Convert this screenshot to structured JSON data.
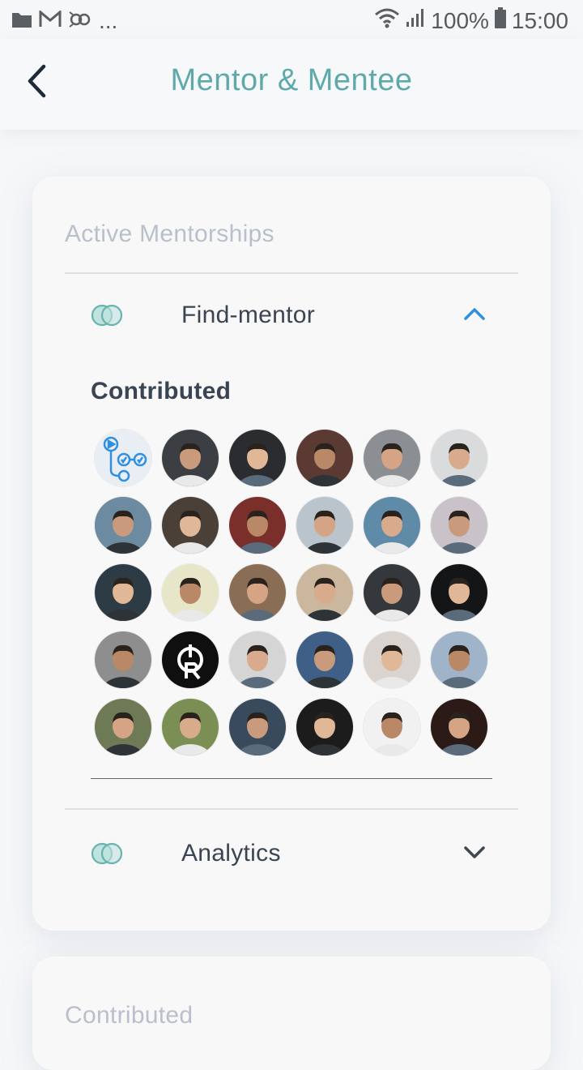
{
  "status_bar": {
    "battery": "100%",
    "time": "15:00",
    "notification_icons": [
      "folder-icon",
      "gmail-icon",
      "link-icon"
    ],
    "overflow": "..."
  },
  "header": {
    "title": "Mentor & Mentee"
  },
  "active_mentorships": {
    "heading": "Active Mentorships",
    "items": [
      {
        "label": "Find-mentor",
        "expanded": true
      },
      {
        "label": "Analytics",
        "expanded": false
      }
    ],
    "contributed_heading": "Contributed",
    "contributors_count": 30
  },
  "contributed_card": {
    "heading": "Contributed"
  },
  "colors": {
    "accent": "#5fa9ab",
    "chevron_active": "#2f8fe0",
    "text_dark": "#3a4452",
    "text_muted": "#b9c0cc"
  }
}
